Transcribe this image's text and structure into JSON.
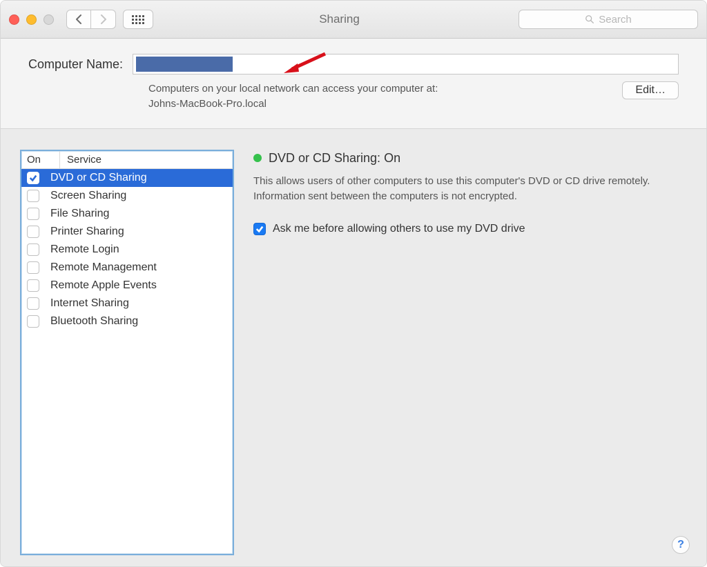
{
  "window": {
    "title": "Sharing"
  },
  "search": {
    "placeholder": "Search"
  },
  "computer_name": {
    "label": "Computer Name:",
    "help_line1": "Computers on your local network can access your computer at:",
    "help_line2": "Johns-MacBook-Pro.local",
    "edit_label": "Edit…"
  },
  "list": {
    "col_on": "On",
    "col_service": "Service",
    "items": [
      {
        "checked": true,
        "label": "DVD or CD Sharing",
        "selected": true
      },
      {
        "checked": false,
        "label": "Screen Sharing"
      },
      {
        "checked": false,
        "label": "File Sharing"
      },
      {
        "checked": false,
        "label": "Printer Sharing"
      },
      {
        "checked": false,
        "label": "Remote Login"
      },
      {
        "checked": false,
        "label": "Remote Management"
      },
      {
        "checked": false,
        "label": "Remote Apple Events"
      },
      {
        "checked": false,
        "label": "Internet Sharing"
      },
      {
        "checked": false,
        "label": "Bluetooth Sharing"
      }
    ]
  },
  "detail": {
    "status_title": "DVD or CD Sharing:",
    "status_state": "On",
    "description": "This allows users of other computers to use this computer's DVD or CD drive remotely. Information sent between the computers is not encrypted.",
    "option_label": "Ask me before allowing others to use my DVD drive",
    "option_checked": true
  },
  "help_button": "?"
}
